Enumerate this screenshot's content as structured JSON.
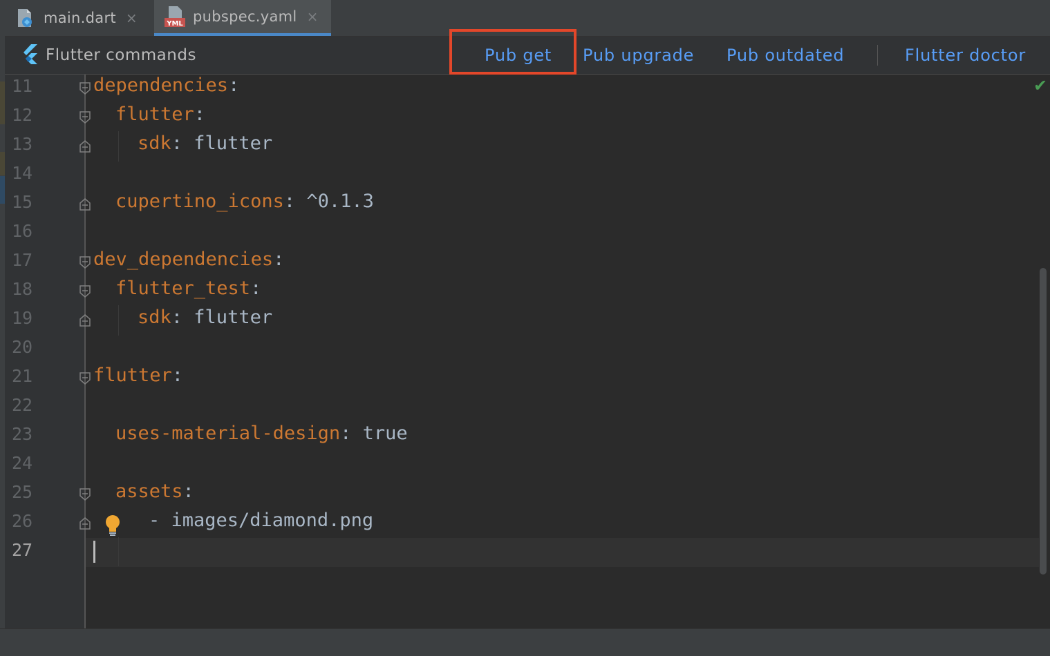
{
  "tabs": [
    {
      "label": "main.dart",
      "icon": "dart-file-icon"
    },
    {
      "label": "pubspec.yaml",
      "icon": "yaml-file-icon"
    }
  ],
  "tab_close_glyph": "×",
  "flutter_commands": {
    "title": "Flutter commands",
    "pub_get": "Pub get",
    "pub_upgrade": "Pub upgrade",
    "pub_outdated": "Pub outdated",
    "flutter_doctor": "Flutter doctor"
  },
  "editor": {
    "line_numbers": [
      "11",
      "12",
      "13",
      "14",
      "15",
      "16",
      "17",
      "18",
      "19",
      "20",
      "21",
      "22",
      "23",
      "24",
      "25",
      "26",
      "27"
    ],
    "current_line": "27",
    "lines": {
      "l11": {
        "key": "dependencies",
        "sep": ":"
      },
      "l12": {
        "key": "flutter",
        "sep": ":"
      },
      "l13": {
        "key": "sdk",
        "sep": ": ",
        "value": "flutter"
      },
      "l15": {
        "key": "cupertino_icons",
        "sep": ": ",
        "value": "^0.1.3"
      },
      "l17": {
        "key": "dev_dependencies",
        "sep": ":"
      },
      "l18": {
        "key": "flutter_test",
        "sep": ":"
      },
      "l19": {
        "key": "sdk",
        "sep": ": ",
        "value": "flutter"
      },
      "l21": {
        "key": "flutter",
        "sep": ":"
      },
      "l23": {
        "key": "uses-material-design",
        "sep": ": ",
        "value": "true"
      },
      "l25": {
        "key": "assets",
        "sep": ":"
      },
      "l26": {
        "value": "- images/diamond.png"
      }
    }
  },
  "status_check": "✔",
  "colors": {
    "accent_link": "#589df6",
    "yaml_key": "#cc7832",
    "highlight_box": "#e3472a",
    "tab_underline": "#4a88c7"
  }
}
